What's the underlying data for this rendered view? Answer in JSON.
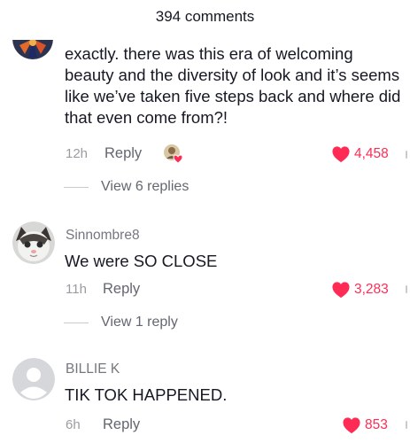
{
  "header": {
    "title": "394 comments"
  },
  "comments": [
    {
      "username": "",
      "text": "exactly. there was this era of welcoming beauty and the diversity of look and it’s seems like we’ve taken five steps back and where did that even come from?!",
      "time": "12h",
      "reply_label": "Reply",
      "likes": "4,458",
      "creator_liked": true,
      "view_replies": "View 6 replies"
    },
    {
      "username": "Sinnombre8",
      "text": "We were SO CLOSE",
      "time": "11h",
      "reply_label": "Reply",
      "likes": "3,283",
      "view_replies": "View 1 reply"
    },
    {
      "username": "BILLIE K",
      "text": "TIK TOK HAPPENED.",
      "time": "6h",
      "reply_label": "Reply",
      "likes": "853"
    }
  ],
  "colors": {
    "like": "#fe2c55",
    "muted": "#75777f",
    "text": "#161823"
  },
  "icons": {
    "like": "heart-icon",
    "default_avatar": "default-avatar-icon"
  }
}
